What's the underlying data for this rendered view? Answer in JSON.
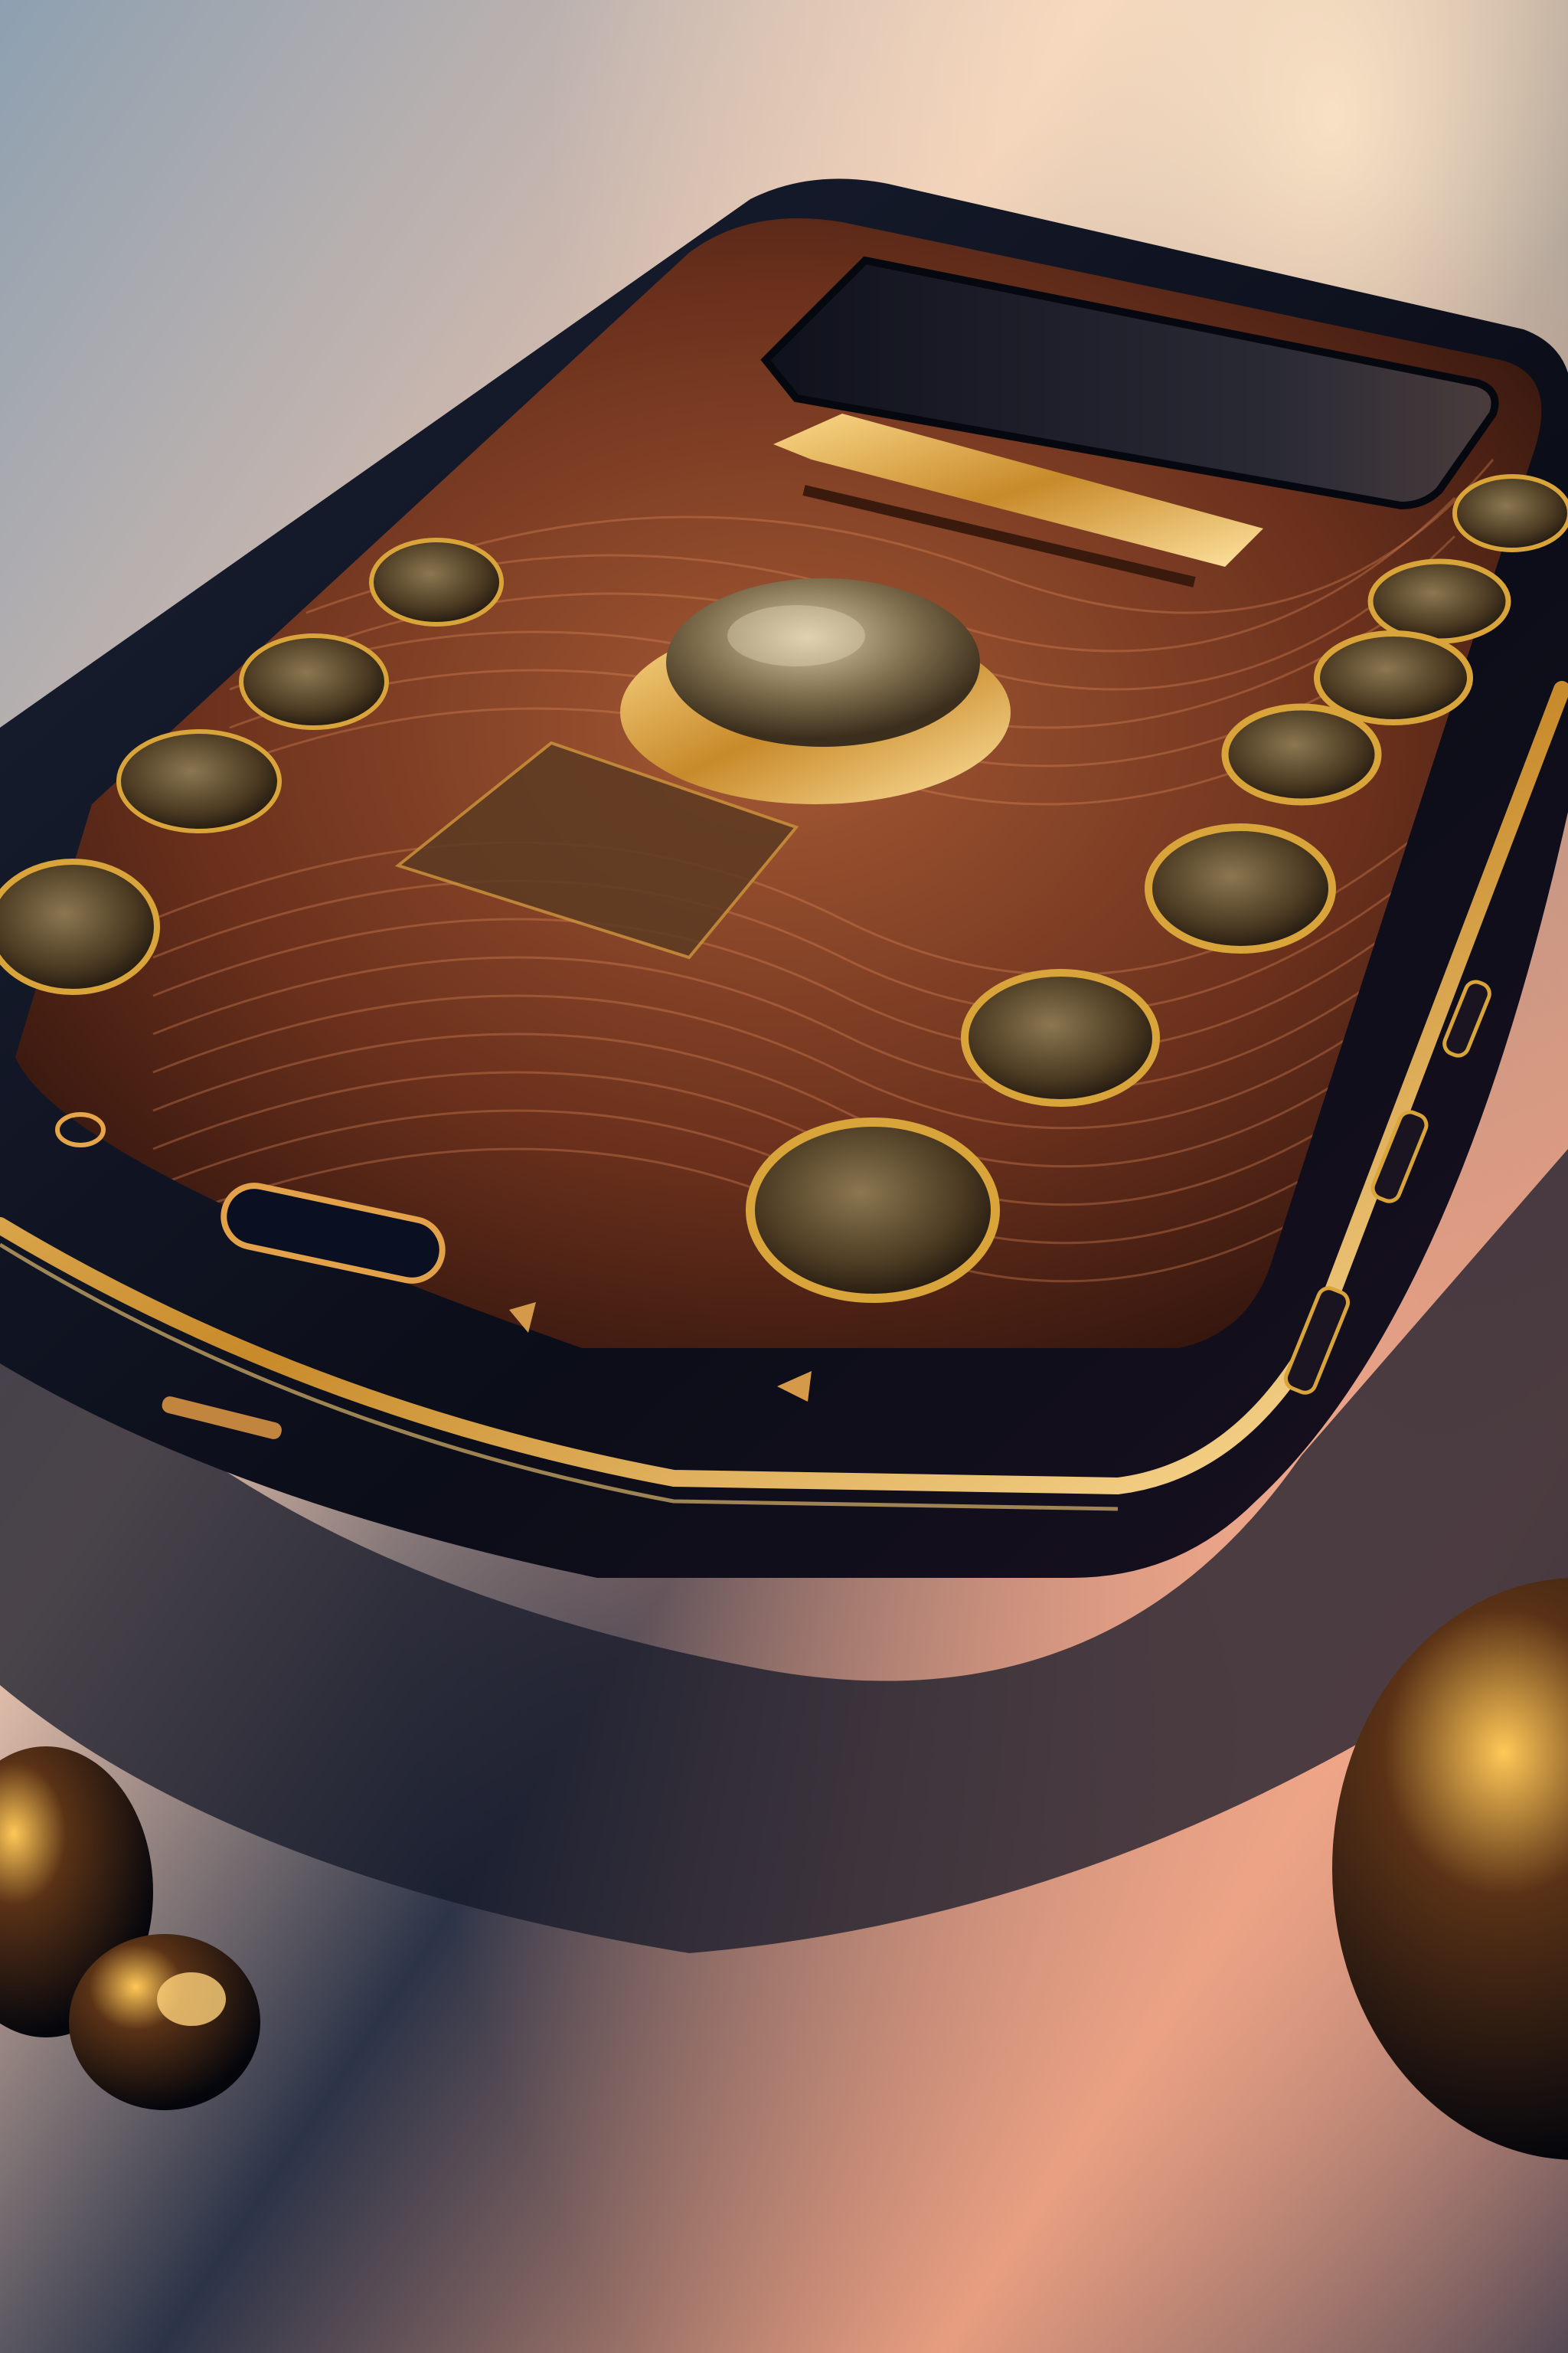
{
  "image": {
    "subject": "ornate-smartphone",
    "palette": {
      "background_top": "#8fa2b3",
      "background_warm": "#f4c9a8",
      "background_pink": "#e8a58f",
      "background_shadow": "#1c2234",
      "phone_body": "#0d1020",
      "gold": "#d9a43a",
      "gold_highlight": "#ffd27a",
      "copper": "#7a3c22",
      "copper_dark": "#3a1a12",
      "screen": "#171a2a"
    }
  }
}
